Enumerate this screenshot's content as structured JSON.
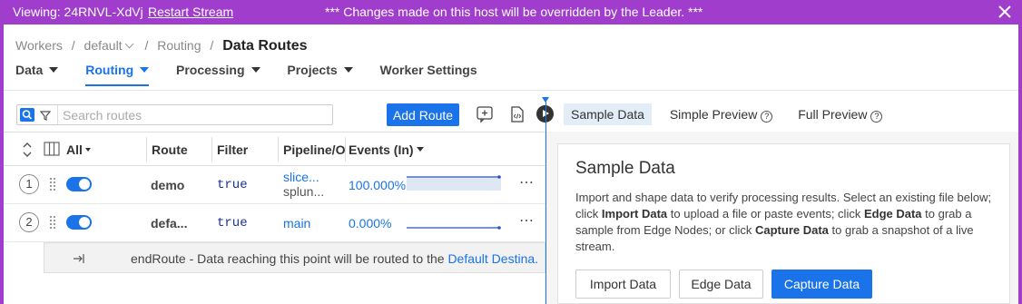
{
  "banner": {
    "viewing": "Viewing: 24RNVL-XdVj",
    "restart": "Restart Stream",
    "message": "*** Changes made on this host will be overridden by the Leader. ***",
    "bg_color": "#a13dcc"
  },
  "breadcrumb": {
    "items": [
      "Workers",
      "default",
      "Routing"
    ],
    "current": "Data Routes",
    "sep": "/"
  },
  "tabs": [
    {
      "label": "Data"
    },
    {
      "label": "Routing"
    },
    {
      "label": "Processing"
    },
    {
      "label": "Projects"
    },
    {
      "label": "Worker Settings"
    }
  ],
  "search": {
    "placeholder": "Search routes"
  },
  "toolbar": {
    "add_route": "Add Route"
  },
  "preview_tabs": [
    "Sample Data",
    "Simple Preview",
    "Full Preview"
  ],
  "table": {
    "headers": {
      "all": "All",
      "route": "Route",
      "filter": "Filter",
      "pipeline": "Pipeline/O",
      "events": "Events (In)"
    },
    "rows": [
      {
        "num": "1",
        "route": "demo",
        "filter": "true",
        "pipeline": "slice...",
        "output": "splun...",
        "events": "100.000%",
        "events_level": 1.0
      },
      {
        "num": "2",
        "route": "defa...",
        "filter": "true",
        "pipeline": "main",
        "output": "",
        "events": "0.000%",
        "events_level": 0.0
      }
    ],
    "more_label": "⋯",
    "end_text": "endRoute - Data reaching this point will be routed to the",
    "end_link": "Default Destina..."
  },
  "sample": {
    "title": "Sample Data",
    "p1": "Import and shape data to verify processing results. Select an existing file below; click",
    "b1": "Import Data",
    "p2": "to upload a file or paste events; click",
    "b2": "Edge Data",
    "p3": "to grab a sample from Edge Nodes; or click",
    "b3": "Capture Data",
    "p4": "to grab a snapshot of a live stream.",
    "buttons": {
      "import": "Import Data",
      "edge": "Edge Data",
      "capture": "Capture Data"
    }
  },
  "colors": {
    "accent": "#1a73e8",
    "banner": "#a13dcc"
  }
}
